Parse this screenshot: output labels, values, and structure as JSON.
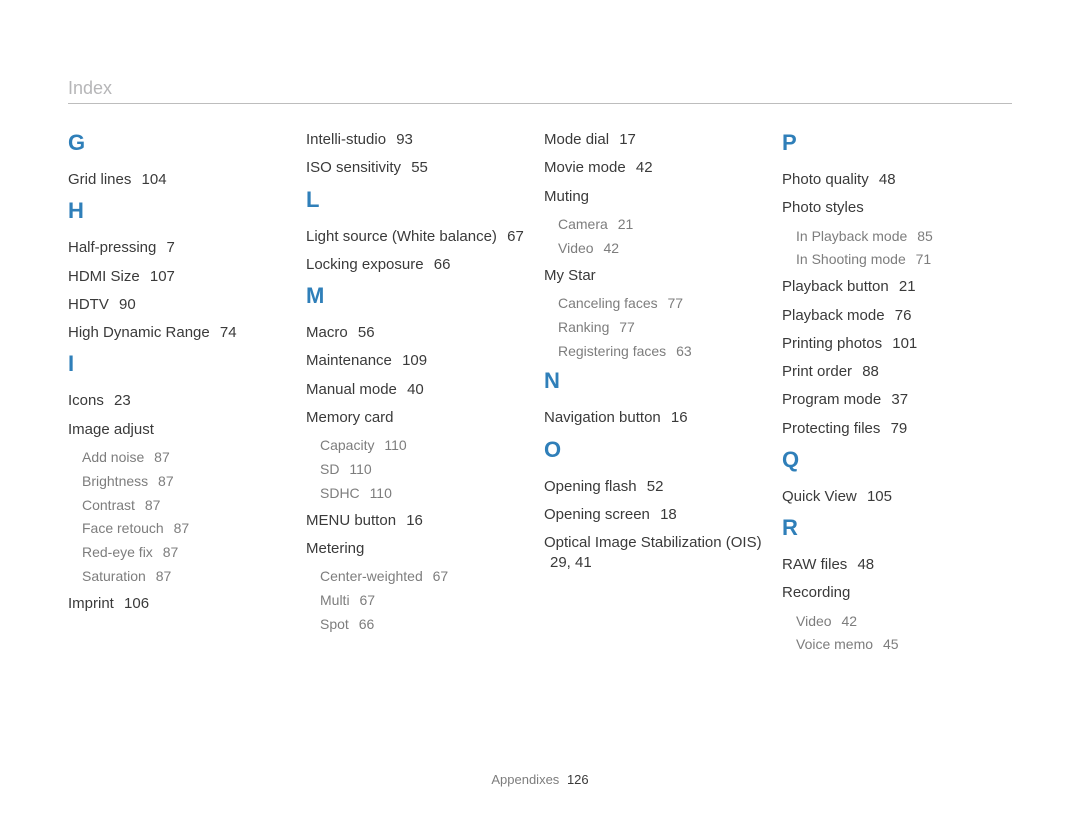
{
  "header": {
    "title": "Index"
  },
  "footer": {
    "label": "Appendixes",
    "page": "126"
  },
  "columns": [
    {
      "sections": [
        {
          "letter": "G",
          "entries": [
            {
              "label": "Grid lines",
              "page": "104"
            }
          ]
        },
        {
          "letter": "H",
          "entries": [
            {
              "label": "Half-pressing",
              "page": "7"
            },
            {
              "label": "HDMI Size",
              "page": "107"
            },
            {
              "label": "HDTV",
              "page": "90"
            },
            {
              "label": "High Dynamic Range",
              "page": "74"
            }
          ]
        },
        {
          "letter": "I",
          "entries": [
            {
              "label": "Icons",
              "page": "23"
            },
            {
              "label": "Image adjust",
              "page": "",
              "subs": [
                {
                  "label": "Add noise",
                  "page": "87"
                },
                {
                  "label": "Brightness",
                  "page": "87"
                },
                {
                  "label": "Contrast",
                  "page": "87"
                },
                {
                  "label": "Face retouch",
                  "page": "87"
                },
                {
                  "label": "Red-eye fix",
                  "page": "87"
                },
                {
                  "label": "Saturation",
                  "page": "87"
                }
              ]
            },
            {
              "label": "Imprint",
              "page": "106"
            }
          ]
        }
      ]
    },
    {
      "sections": [
        {
          "letter": "",
          "entries": [
            {
              "label": "Intelli-studio",
              "page": "93"
            },
            {
              "label": "ISO sensitivity",
              "page": "55"
            }
          ]
        },
        {
          "letter": "L",
          "entries": [
            {
              "label": "Light source (White balance)",
              "page": "67"
            },
            {
              "label": "Locking exposure",
              "page": "66"
            }
          ]
        },
        {
          "letter": "M",
          "entries": [
            {
              "label": "Macro",
              "page": "56"
            },
            {
              "label": "Maintenance",
              "page": "109"
            },
            {
              "label": "Manual mode",
              "page": "40"
            },
            {
              "label": "Memory card",
              "page": "",
              "subs": [
                {
                  "label": "Capacity",
                  "page": "110"
                },
                {
                  "label": "SD",
                  "page": "110"
                },
                {
                  "label": "SDHC",
                  "page": "110"
                }
              ]
            },
            {
              "label": "MENU button",
              "page": "16"
            },
            {
              "label": "Metering",
              "page": "",
              "subs": [
                {
                  "label": "Center-weighted",
                  "page": "67"
                },
                {
                  "label": "Multi",
                  "page": "67"
                },
                {
                  "label": "Spot",
                  "page": "66"
                }
              ]
            }
          ]
        }
      ]
    },
    {
      "sections": [
        {
          "letter": "",
          "entries": [
            {
              "label": "Mode dial",
              "page": "17"
            },
            {
              "label": "Movie mode",
              "page": "42"
            },
            {
              "label": "Muting",
              "page": "",
              "subs": [
                {
                  "label": "Camera",
                  "page": "21"
                },
                {
                  "label": "Video",
                  "page": "42"
                }
              ]
            },
            {
              "label": "My Star",
              "page": "",
              "subs": [
                {
                  "label": "Canceling faces",
                  "page": "77"
                },
                {
                  "label": "Ranking",
                  "page": "77"
                },
                {
                  "label": "Registering faces",
                  "page": "63"
                }
              ]
            }
          ]
        },
        {
          "letter": "N",
          "entries": [
            {
              "label": "Navigation button",
              "page": "16"
            }
          ]
        },
        {
          "letter": "O",
          "entries": [
            {
              "label": "Opening flash",
              "page": "52"
            },
            {
              "label": "Opening screen",
              "page": "18"
            },
            {
              "label": "Optical Image Stabilization (OIS)",
              "page": "29, 41"
            }
          ]
        }
      ]
    },
    {
      "sections": [
        {
          "letter": "P",
          "entries": [
            {
              "label": "Photo quality",
              "page": "48"
            },
            {
              "label": "Photo styles",
              "page": "",
              "subs": [
                {
                  "label": "In Playback mode",
                  "page": "85"
                },
                {
                  "label": "In Shooting mode",
                  "page": "71"
                }
              ]
            },
            {
              "label": "Playback button",
              "page": "21"
            },
            {
              "label": "Playback mode",
              "page": "76"
            },
            {
              "label": "Printing photos",
              "page": "101"
            },
            {
              "label": "Print order",
              "page": "88"
            },
            {
              "label": "Program mode",
              "page": "37"
            },
            {
              "label": "Protecting files",
              "page": "79"
            }
          ]
        },
        {
          "letter": "Q",
          "entries": [
            {
              "label": "Quick View",
              "page": "105"
            }
          ]
        },
        {
          "letter": "R",
          "entries": [
            {
              "label": "RAW files",
              "page": "48"
            },
            {
              "label": "Recording",
              "page": "",
              "subs": [
                {
                  "label": "Video",
                  "page": "42"
                },
                {
                  "label": "Voice memo",
                  "page": "45"
                }
              ]
            }
          ]
        }
      ]
    }
  ]
}
